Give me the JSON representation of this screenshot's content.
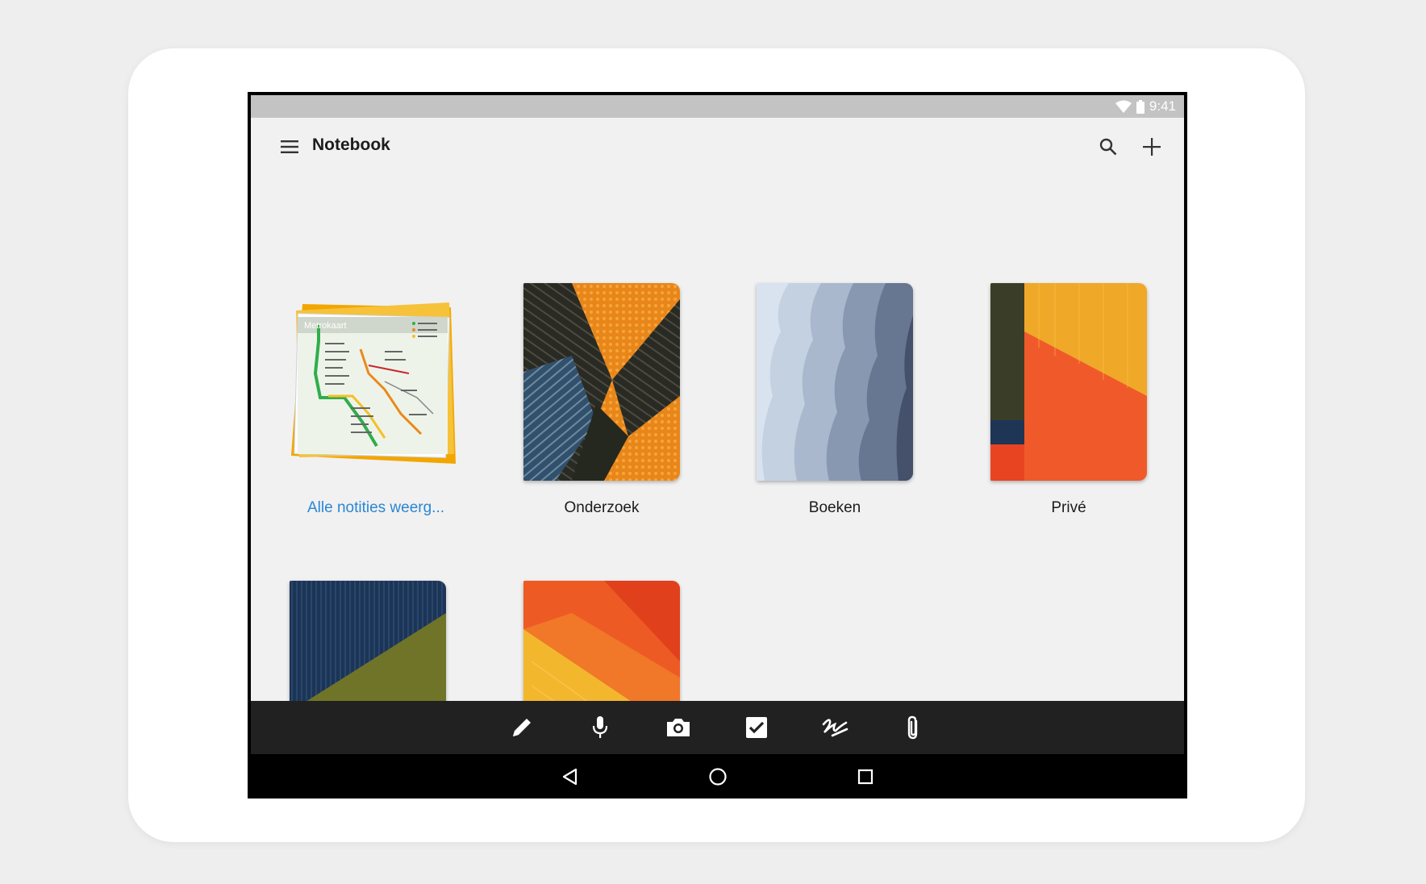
{
  "status_bar": {
    "time": "9:41",
    "icons": [
      "wifi-icon",
      "battery-icon"
    ]
  },
  "toolbar": {
    "title": "Notebook",
    "menu_icon": "menu-icon",
    "search_icon": "search-icon",
    "add_icon": "add-icon"
  },
  "notebooks": [
    {
      "label": "Alle notities weerg...",
      "map_title": "Metrokaart",
      "style": "link"
    },
    {
      "label": "Onderzoek"
    },
    {
      "label": "Boeken"
    },
    {
      "label": "Privé"
    },
    {
      "label": ""
    },
    {
      "label": ""
    }
  ],
  "bottom_tools": [
    "pencil-icon",
    "microphone-icon",
    "camera-icon",
    "checkbox-icon",
    "handwriting-icon",
    "attachment-icon"
  ],
  "nav": [
    "back-icon",
    "home-icon",
    "recents-icon"
  ],
  "colors": {
    "link": "#2a86d4",
    "app_background": "#f1f1f1",
    "status_bar": "#c3c3c3",
    "bottom_toolbar": "#212121"
  }
}
